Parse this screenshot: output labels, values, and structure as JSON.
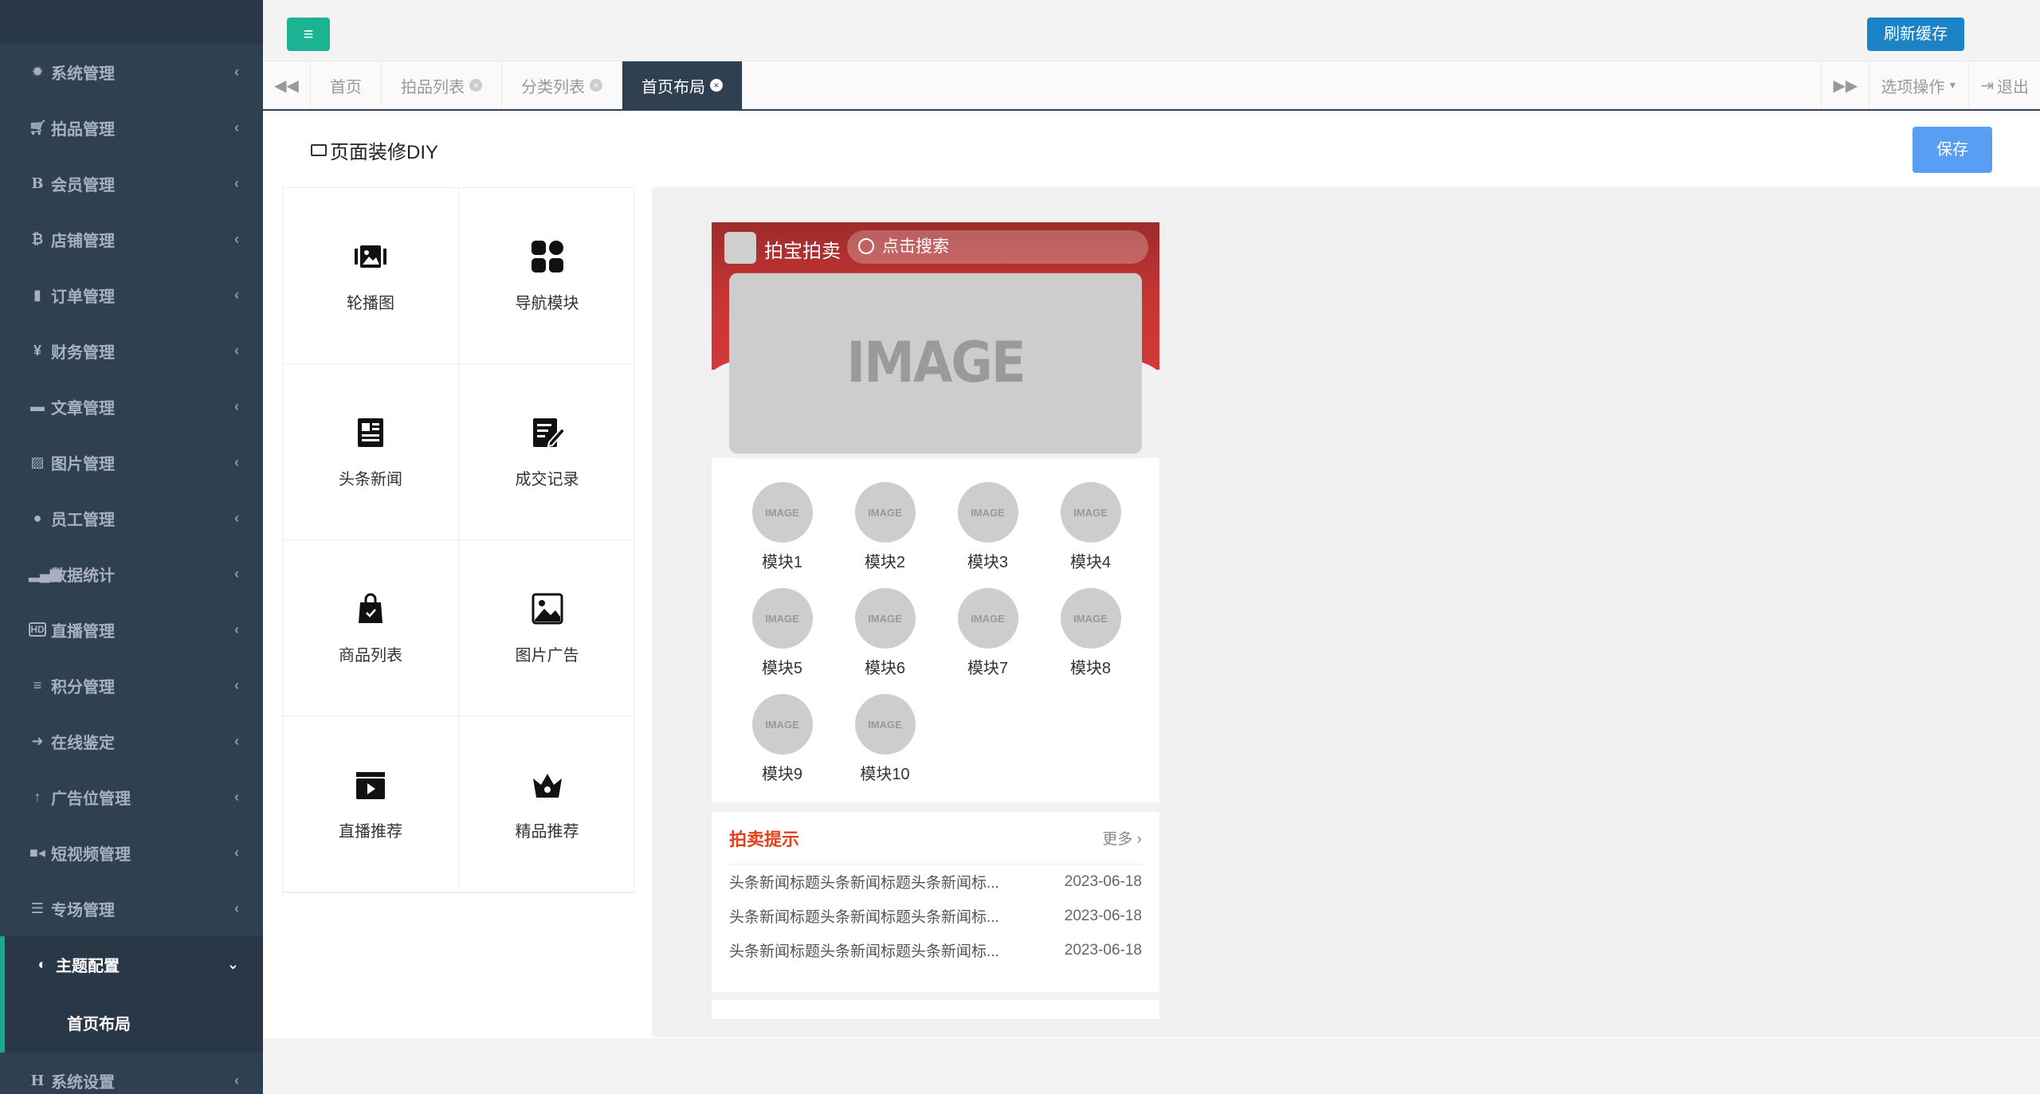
{
  "sidebar": {
    "items": [
      {
        "label": "系统管理",
        "icon": "gear-icon"
      },
      {
        "label": "拍品管理",
        "icon": "cart-icon"
      },
      {
        "label": "会员管理",
        "icon": "bold-icon"
      },
      {
        "label": "店铺管理",
        "icon": "bitcoin-icon"
      },
      {
        "label": "订单管理",
        "icon": "book-icon"
      },
      {
        "label": "财务管理",
        "icon": "yen-icon"
      },
      {
        "label": "文章管理",
        "icon": "folder-icon"
      },
      {
        "label": "图片管理",
        "icon": "picture-icon"
      },
      {
        "label": "员工管理",
        "icon": "user-icon"
      },
      {
        "label": "数据统计",
        "icon": "signal-icon"
      },
      {
        "label": "直播管理",
        "icon": "hd-video-icon"
      },
      {
        "label": "积分管理",
        "icon": "database-icon"
      },
      {
        "label": "在线鉴定",
        "icon": "arrow-right-icon"
      },
      {
        "label": "广告位管理",
        "icon": "arrow-up-icon"
      },
      {
        "label": "短视频管理",
        "icon": "video-camera-icon"
      },
      {
        "label": "专场管理",
        "icon": "list-icon"
      }
    ],
    "active": {
      "label": "主题配置",
      "icon": "contrast-icon",
      "sub": "首页布局"
    },
    "last": {
      "label": "系统设置",
      "icon": "header-icon"
    }
  },
  "topbar": {
    "refresh_label": "刷新缓存"
  },
  "tabs": {
    "items": [
      "首页",
      "拍品列表",
      "分类列表",
      "首页布局"
    ],
    "options_label": "选项操作",
    "logout_label": "退出"
  },
  "page": {
    "title": "页面装修DIY",
    "save_label": "保存"
  },
  "components": [
    "轮播图",
    "导航模块",
    "头条新闻",
    "成交记录",
    "商品列表",
    "图片广告",
    "直播推荐",
    "精品推荐"
  ],
  "phone": {
    "app_title": "拍宝拍卖",
    "search_placeholder": "点击搜索",
    "banner_text": "IMAGE",
    "image_placeholder": "IMAGE",
    "modules": [
      "模块1",
      "模块2",
      "模块3",
      "模块4",
      "模块5",
      "模块6",
      "模块7",
      "模块8",
      "模块9",
      "模块10"
    ],
    "news": {
      "title": "拍卖提示",
      "more_label": "更多",
      "rows": [
        {
          "text": "头条新闻标题头条新闻标题头条新闻标...",
          "date": "2023-06-18"
        },
        {
          "text": "头条新闻标题头条新闻标题头条新闻标...",
          "date": "2023-06-18"
        },
        {
          "text": "头条新闻标题头条新闻标题头条新闻标...",
          "date": "2023-06-18"
        }
      ]
    }
  },
  "colors": {
    "sidebar": "#2f4050",
    "accent": "#1ab394",
    "primary": "#1c84c6",
    "save": "#5a9ef4",
    "phone_header": "#c73434",
    "news_title": "#e0441f"
  }
}
